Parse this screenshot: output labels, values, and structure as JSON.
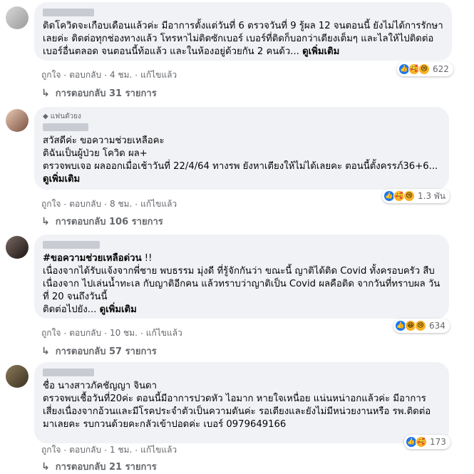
{
  "comments": [
    {
      "badge": "",
      "text": "ติดโควิดจะเกือบเดือนแล้วค่ะ มีอาการตั้งแต่วันที่ 6 ตรวจวันที่ 9 รู้ผล 12 จนตอนนี้ ยังไม่ได้การรักษาเลยค่ะ ติดต่อทุกช่องทางแล้ว โทรหาไม่ติดซักเบอร์ เบอร์ที่ติดก็บอกว่าเตียงเต็มๆ และไลให้ไปติดต่อเบอร์อื่นตลอด จนตอนนี้ท้อแล้ว และในห้องอยู่ด้วยกัน 2 คนด้ว...",
      "see_more": "ดูเพิ่มเติม",
      "like": "ถูกใจ",
      "reply": "ตอบกลับ",
      "time": "4 ชม.",
      "edited": "แก้ไขแล้ว",
      "reaction_count": "622",
      "replies": "การตอบกลับ 31 รายการ"
    },
    {
      "badge": "แฟนตัวยง",
      "text": "สวัสดีค่ะ ขอความช่วยเหลือคะ\nติฉันเป็นผู้ป่วย โควิด ผล+\nตรวจพบเจอ ผลออกเมื่อเช้าวันที่ 22/4/64 ทางรพ ยังหาเตียงให้ไม่ได้เลยคะ ตอนนี้ตั้งครรภ์36+6...",
      "see_more": "ดูเพิ่มเติม",
      "like": "ถูกใจ",
      "reply": "ตอบกลับ",
      "time": "8 ชม.",
      "edited": "แก้ไขแล้ว",
      "reaction_count": "1.3 พัน",
      "replies": "การตอบกลับ 106 รายการ"
    },
    {
      "badge": "",
      "hashtag": "#ขอความช่วยเหลือด่วน",
      "hashtag_suffix": " !!",
      "text": "เนื่องจากได้รับแจ้งจากพี่ชาย พบธรรม มุ่งดี ที่รู้จักกันว่า ขณะนี้ ญาติได้ติด Covid ทั้งครอบครัว สืบเนื่องจาก ไปเล่นน้ำทะเล กับญาติอีกคน แล้วทราบว่าญาติเป็น Covid ผลคือติด จากวันที่ทราบผล วันที่ 20 จนถึงวันนี้\nติดต่อไปยัง...",
      "see_more": "ดูเพิ่มเติม",
      "like": "ถูกใจ",
      "reply": "ตอบกลับ",
      "time": "10 ชม.",
      "edited": "แก้ไขแล้ว",
      "reaction_count": "634",
      "replies": "การตอบกลับ 57 รายการ"
    },
    {
      "badge": "",
      "text": "ชื่อ นางสาวภัคชัญญา จินดา\nตรวจพบเชื้อวันที่20ค่ะ ตอนนี้มีอาการปวดหัว ไอมาก หายใจเหนื่อย แน่นหน่าอกแล้วค่ะ มีอาการเสี่ยงเนื่องจากอ้วนและมีโรคประจำตัวเป็นความดันค่ะ รอเตียงและยังไม่มีหน่วยงานหรือ รพ.ติดต่อมาเลยคะ รบกวนด้วยคะกลัวเข้าปอดค่ะ เบอร์ 0979649166",
      "like": "ถูกใจ",
      "reply": "ตอบกลับ",
      "time": "1 ชม.",
      "edited": "แก้ไขแล้ว",
      "reaction_count": "173",
      "replies": "การตอบกลับ 21 รายการ"
    }
  ]
}
